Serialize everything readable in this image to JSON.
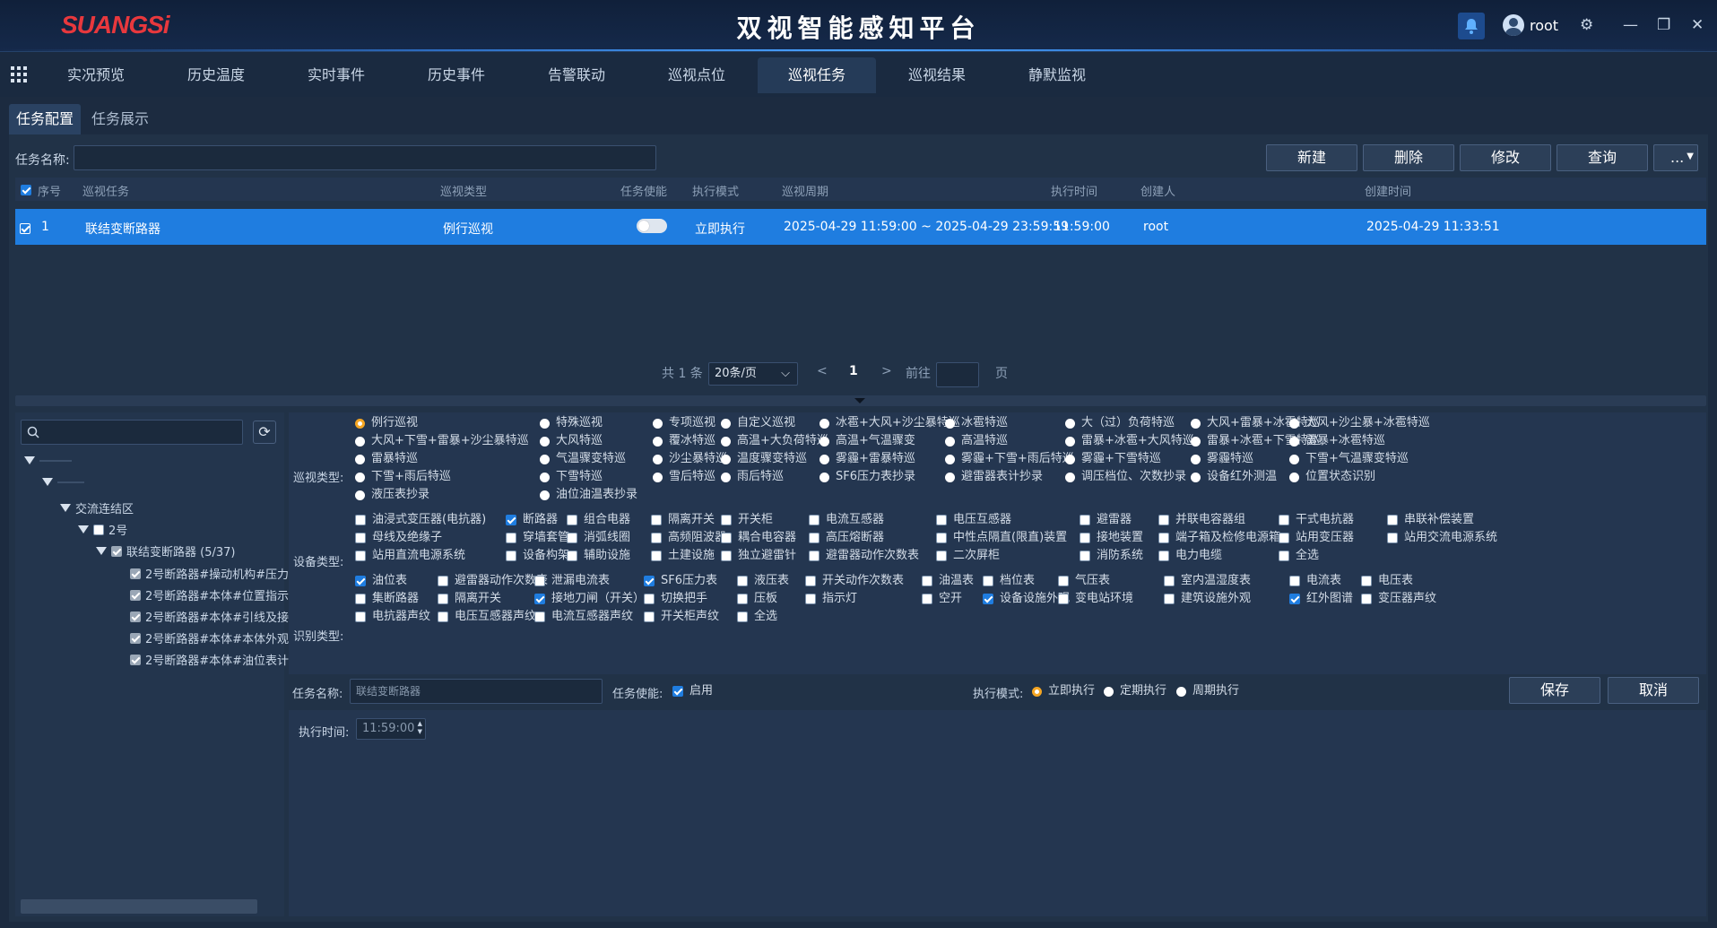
{
  "app": {
    "logo": "SUANGSi",
    "title": "双视智能感知平台",
    "user": "root"
  },
  "nav": [
    "实况预览",
    "历史温度",
    "实时事件",
    "历史事件",
    "告警联动",
    "巡视点位",
    "巡视任务",
    "巡视结果",
    "静默监视"
  ],
  "subtabs": [
    "任务配置",
    "任务展示"
  ],
  "search": {
    "label": "任务名称:",
    "value": ""
  },
  "toolbar": {
    "new": "新建",
    "delete": "删除",
    "edit": "修改",
    "query": "查询",
    "more": "..."
  },
  "table": {
    "headers": [
      "序号",
      "巡视任务",
      "巡视类型",
      "任务使能",
      "执行模式",
      "巡视周期",
      "执行时间",
      "创建人",
      "创建时间"
    ],
    "rows": [
      {
        "no": "1",
        "task": "联结变断路器",
        "type": "例行巡视",
        "mode": "立即执行",
        "period": "2025-04-29 11:59:00 ~ 2025-04-29 23:59:59",
        "time": "11:59:00",
        "creator": "root",
        "created": "2025-04-29 11:33:51"
      }
    ]
  },
  "pager": {
    "total": "共 1 条",
    "size": "20条/页",
    "prev": "<",
    "page": "1",
    "next": ">",
    "goto": "前往",
    "unit": "页"
  },
  "tree": {
    "area": "交流连结区",
    "node2": "2号",
    "breaker": "联结变断路器 (5/37)",
    "leaves": [
      "2号断路器#操动机构#压力",
      "2号断路器#本体#位置指示",
      "2号断路器#本体#引线及接",
      "2号断路器#本体#本体外观",
      "2号断路器#本体#油位表计"
    ]
  },
  "patrol_label": "巡视类型:",
  "patrol_types": [
    [
      "例行巡视",
      "特殊巡视",
      "专项巡视",
      "自定义巡视",
      "冰雹+大风+沙尘暴特巡",
      "冰雹特巡",
      "大（过）负荷特巡",
      "大风+雷暴+冰雹特巡",
      "大风+沙尘暴+冰雹特巡"
    ],
    [
      "大风+下雪+雷暴+沙尘暴特巡",
      "大风特巡",
      "覆冰特巡",
      "高温+大负荷特巡",
      "高温+气温骤变",
      "高温特巡",
      "雷暴+冰雹+大风特巡",
      "雷暴+冰雹+下雪特巡",
      "雷暴+冰雹特巡"
    ],
    [
      "雷暴特巡",
      "气温骤变特巡",
      "沙尘暴特巡",
      "温度骤变特巡",
      "雾霾+雷暴特巡",
      "雾霾+下雪+雨后特巡",
      "雾霾+下雪特巡",
      "雾霾特巡",
      "下雪+气温骤变特巡"
    ],
    [
      "下雪+雨后特巡",
      "下雪特巡",
      "雪后特巡",
      "雨后特巡",
      "SF6压力表抄录",
      "避雷器表计抄录",
      "调压档位、次数抄录",
      "设备红外测温",
      "位置状态识别"
    ],
    [
      "液压表抄录",
      "油位油温表抄录"
    ]
  ],
  "device_label": "设备类型:",
  "device_types": [
    [
      [
        "油浸式变压器(电抗器)",
        false
      ],
      [
        "断路器",
        true
      ],
      [
        "组合电器",
        false
      ],
      [
        "隔离开关",
        false
      ],
      [
        "开关柜",
        false
      ],
      [
        "电流互感器",
        false
      ],
      [
        "电压互感器",
        false
      ],
      [
        "避雷器",
        false
      ],
      [
        "并联电容器组",
        false
      ],
      [
        "干式电抗器",
        false
      ],
      [
        "串联补偿装置",
        false
      ]
    ],
    [
      [
        "母线及绝缘子",
        false
      ],
      [
        "穿墙套管",
        false
      ],
      [
        "消弧线圈",
        false
      ],
      [
        "高频阻波器",
        false
      ],
      [
        "耦合电容器",
        false
      ],
      [
        "高压熔断器",
        false
      ],
      [
        "中性点隔直(限直)装置",
        false
      ],
      [
        "接地装置",
        false
      ],
      [
        "端子箱及检修电源箱",
        false
      ],
      [
        "站用变压器",
        false
      ],
      [
        "站用交流电源系统",
        false
      ]
    ],
    [
      [
        "站用直流电源系统",
        false
      ],
      [
        "设备构架",
        false
      ],
      [
        "辅助设施",
        false
      ],
      [
        "土建设施",
        false
      ],
      [
        "独立避雷针",
        false
      ],
      [
        "避雷器动作次数表",
        false
      ],
      [
        "二次屏柜",
        false
      ],
      [
        "消防系统",
        false
      ],
      [
        "电力电缆",
        false
      ],
      [
        "全选",
        false
      ]
    ]
  ],
  "recog_label": "识别类型:",
  "recog_types": [
    [
      [
        "油位表",
        true
      ],
      [
        "避雷器动作次数表",
        false
      ],
      [
        "泄漏电流表",
        false
      ],
      [
        "SF6压力表",
        true
      ],
      [
        "液压表",
        false
      ],
      [
        "开关动作次数表",
        false
      ],
      [
        "油温表",
        false
      ],
      [
        "档位表",
        false
      ],
      [
        "气压表",
        false
      ],
      [
        "室内温湿度表",
        false
      ],
      [
        "电流表",
        false
      ],
      [
        "电压表",
        false
      ]
    ],
    [
      [
        "集断路器",
        false
      ],
      [
        "隔离开关",
        false
      ],
      [
        "接地刀闸（开关）",
        true
      ],
      [
        "切换把手",
        false
      ],
      [
        "压板",
        false
      ],
      [
        "指示灯",
        false
      ],
      [
        "空开",
        false
      ],
      [
        "设备设施外观",
        true
      ],
      [
        "变电站环境",
        false
      ],
      [
        "建筑设施外观",
        false
      ],
      [
        "红外图谱",
        true
      ],
      [
        "变压器声纹",
        false
      ]
    ],
    [
      [
        "电抗器声纹",
        false
      ],
      [
        "电压互感器声纹",
        false
      ],
      [
        "电流互感器声纹",
        false
      ],
      [
        "开关柜声纹",
        false
      ],
      [
        "全选",
        false
      ]
    ]
  ],
  "form": {
    "name_label": "任务名称:",
    "name_value": "联结变断路器",
    "enable_label": "任务使能:",
    "enable_value": "启用",
    "mode_label": "执行模式:",
    "modes": [
      "立即执行",
      "定期执行",
      "周期执行"
    ],
    "save": "保存",
    "cancel": "取消",
    "time_label": "执行时间:",
    "time_value": "11:59:00"
  },
  "colors": {
    "accent": "#1f7de0",
    "radio_on": "#f5a623"
  }
}
